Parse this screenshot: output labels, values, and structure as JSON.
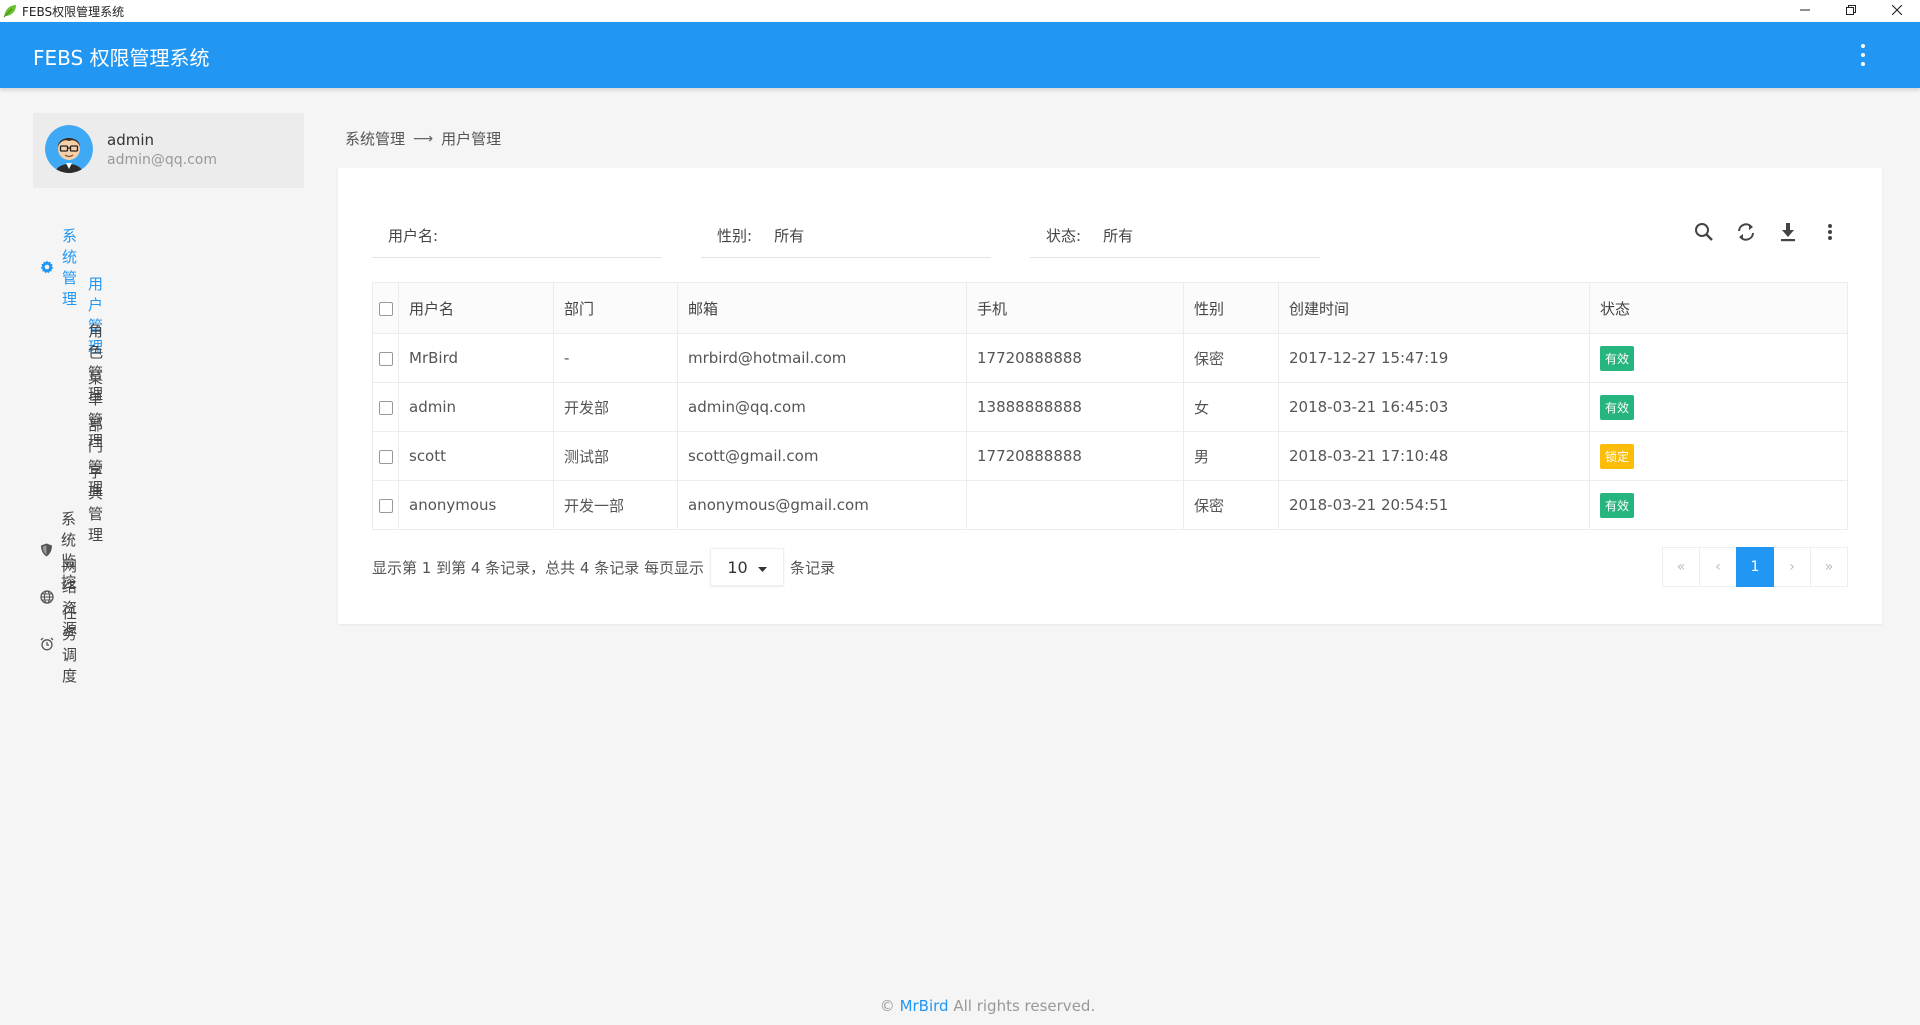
{
  "window": {
    "title": "FEBS权限管理系统",
    "min_icon": "minimize-icon",
    "restore_icon": "restore-icon",
    "close_icon": "close-icon"
  },
  "header": {
    "title": "FEBS 权限管理系统",
    "menu_icon": "more-vertical-icon",
    "color": "#2196f3"
  },
  "user": {
    "name": "admin",
    "email": "admin@qq.com"
  },
  "sidebar": {
    "groups": [
      {
        "label": "系统管理",
        "icon": "gear-icon",
        "active": true,
        "items": [
          "用户管理",
          "角色管理",
          "菜单管理",
          "部门管理",
          "字典管理"
        ]
      },
      {
        "label": "系统监控",
        "icon": "shield-icon"
      },
      {
        "label": "网络资源",
        "icon": "globe-icon"
      },
      {
        "label": "任务调度",
        "icon": "alarm-clock-icon"
      }
    ],
    "active_item": "用户管理"
  },
  "breadcrumb": {
    "parent": "系统管理",
    "current": "用户管理"
  },
  "filters": {
    "username": {
      "label": "用户名:",
      "value": ""
    },
    "gender": {
      "label": "性别:",
      "value": "所有"
    },
    "status": {
      "label": "状态:",
      "value": "所有"
    }
  },
  "toolbar": [
    "search-icon",
    "refresh-icon",
    "download-icon",
    "more-vertical-icon"
  ],
  "table": {
    "columns": [
      "用户名",
      "部门",
      "邮箱",
      "手机",
      "性别",
      "创建时间",
      "状态"
    ],
    "rows": [
      {
        "username": "MrBird",
        "dept": "-",
        "email": "mrbird@hotmail.com",
        "phone": "17720888888",
        "gender": "保密",
        "created": "2017-12-27 15:47:19",
        "status": "有效"
      },
      {
        "username": "admin",
        "dept": "开发部",
        "email": "admin@qq.com",
        "phone": "13888888888",
        "gender": "女",
        "created": "2018-03-21 16:45:03",
        "status": "有效"
      },
      {
        "username": "scott",
        "dept": "测试部",
        "email": "scott@gmail.com",
        "phone": "17720888888",
        "gender": "男",
        "created": "2018-03-21 17:10:48",
        "status": "锁定"
      },
      {
        "username": "anonymous",
        "dept": "开发一部",
        "email": "anonymous@gmail.com",
        "phone": "",
        "gender": "保密",
        "created": "2018-03-21 20:54:51",
        "status": "有效"
      }
    ],
    "status_colors": {
      "有效": "#26b47f",
      "锁定": "#fbbd08"
    }
  },
  "pagination": {
    "info_prefix": "显示第 1 到第 4 条记录，总共 4 条记录 每页显示",
    "page_size": "10",
    "info_suffix": "条记录",
    "buttons": [
      "«",
      "‹",
      "1",
      "›",
      "»"
    ],
    "current": "1"
  },
  "footer": {
    "symbol": "©",
    "author": "MrBird",
    "text": "All rights reserved."
  }
}
